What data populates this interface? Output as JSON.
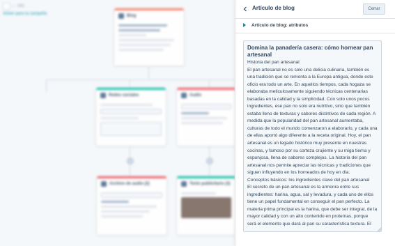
{
  "background": {
    "breadcrumb": "Info",
    "back_link": "Volver para la campaña",
    "cards": [
      {
        "title": "Blog",
        "accent": "#ff7a59"
      },
      {
        "title": "Redes sociales",
        "accent": "#00bda5"
      },
      {
        "title": "Audio",
        "accent": "#f2545b"
      },
      {
        "title": "Archivo de audio (2)",
        "accent": "#f2545b"
      },
      {
        "title": "Texto publicitario (3)",
        "accent": "#00bda5"
      }
    ]
  },
  "panel": {
    "title": "Artículo de blog",
    "close_label": "Cerrar",
    "section_label": "Artículo de blog: atributos",
    "editor": {
      "heading": "Domina la panadería casera: cómo hornear pan artesanal",
      "body": "Historia del pan artesanal\nEl pan artesanal no es solo una delicia culinaria, también es una tradición que se remonta a la Europa antigua, donde este oficio era todo un arte. En aquellos tiempos, cada hogaza se elaboraba meticulosamente siguiendo técnicas centenarias basadas en la calidad y la simplicidad. Con solo unos pocos ingredientes, ese pan no solo era nutritivo, sino que también estaba lleno de texturas y sabores distintivos de cada región. A medida que la popularidad del pan artesanal aumentaba, culturas de todo el mundo comenzaron a elaborarlo, y cada una de ellas aportó algo diferente a la receta original. Hoy, el pan artesanal es un legado histórico muy presente en nuestras cocinas, y famoso por su corteza crujiente y su miga tierna y esponjosa, llena de sabores complejos. La historia del pan artesanal nos permite apreciar las técnicas y tradiciones que siguen influyendo en los horneados de hoy en día.\nConceptos básicos: los ingredientes clave del pan artesanal\nEl secreto de un pan artesanal es la armonía entre sus ingredientes: harina, agua, sal y levadura, y cada uno de ellos tiene un papel fundamental en conseguir el pan perfecto. La materia prima principal es la harina, que debe ser integral, de la mayor calidad y con un alto contenido en proteínas, porque será el elemento que dará al pan su característica textura. El"
    }
  },
  "colors": {
    "accent_link": "#0091ae",
    "text": "#33475b",
    "border": "#cbd6e2"
  }
}
